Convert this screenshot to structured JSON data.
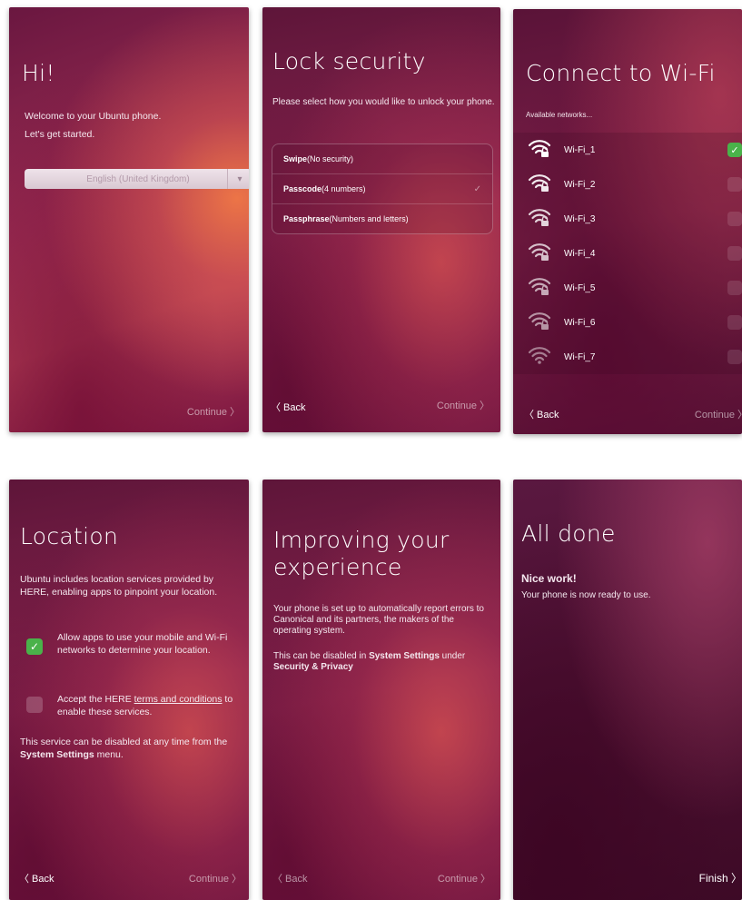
{
  "screen1": {
    "title": "Hi!",
    "welcome": "Welcome to your Ubuntu phone.",
    "started": "Let's get started.",
    "language": "English (United Kingdom)",
    "continue": "Continue 〉"
  },
  "screen2": {
    "title": "Lock security",
    "desc": "Please select how you would like to unlock your phone.",
    "options": [
      {
        "label": "Swipe",
        "hint": " (No security)"
      },
      {
        "label": "Passcode",
        "hint": " (4 numbers)"
      },
      {
        "label": "Passphrase",
        "hint": " (Numbers and letters)"
      }
    ],
    "back": "〈 Back",
    "continue": "Continue 〉"
  },
  "screen3": {
    "title": "Connect to Wi-Fi",
    "available": "Available networks...",
    "networks": [
      "Wi-Fi_1",
      "Wi-Fi_2",
      "Wi-Fi_3",
      "Wi-Fi_4",
      "Wi-Fi_5",
      "Wi-Fi_6",
      "Wi-Fi_7"
    ],
    "back": "〈 Back",
    "continue": "Continue 〉"
  },
  "screen4": {
    "title": "Location",
    "desc": "Ubuntu includes location services provided by HERE, enabling apps to pinpoint your location.",
    "allow": "Allow apps to use your mobile and Wi-Fi networks to determine your location.",
    "accept_pre": "Accept the HERE ",
    "accept_link": "terms and conditions",
    "accept_post": " to enable these services.",
    "note_pre": "This service can be disabled at any time from the ",
    "note_bold": "System Settings",
    "note_post": " menu.",
    "back": "〈 Back",
    "continue": "Continue 〉"
  },
  "screen5": {
    "title": "Improving your experience",
    "desc": "Your phone is set up to automatically report errors to Canonical and its partners, the makers of the operating system.",
    "note_pre": "This can be disabled in ",
    "note_bold1": "System Settings",
    "note_mid": " under ",
    "note_bold2": "Security & Privacy",
    "back": "〈 Back",
    "continue": "Continue 〉"
  },
  "screen6": {
    "title": "All done",
    "nice": "Nice work!",
    "ready": "Your phone is now ready to use.",
    "finish": "Finish 〉"
  },
  "colors": {
    "accent_green": "#4ab24a",
    "aubergine": "#7e2049",
    "orange_glow": "#f07846"
  },
  "icons": {
    "wifi": "wifi-lock-icon",
    "check": "check-icon",
    "chevron": "chevron-down-icon"
  }
}
